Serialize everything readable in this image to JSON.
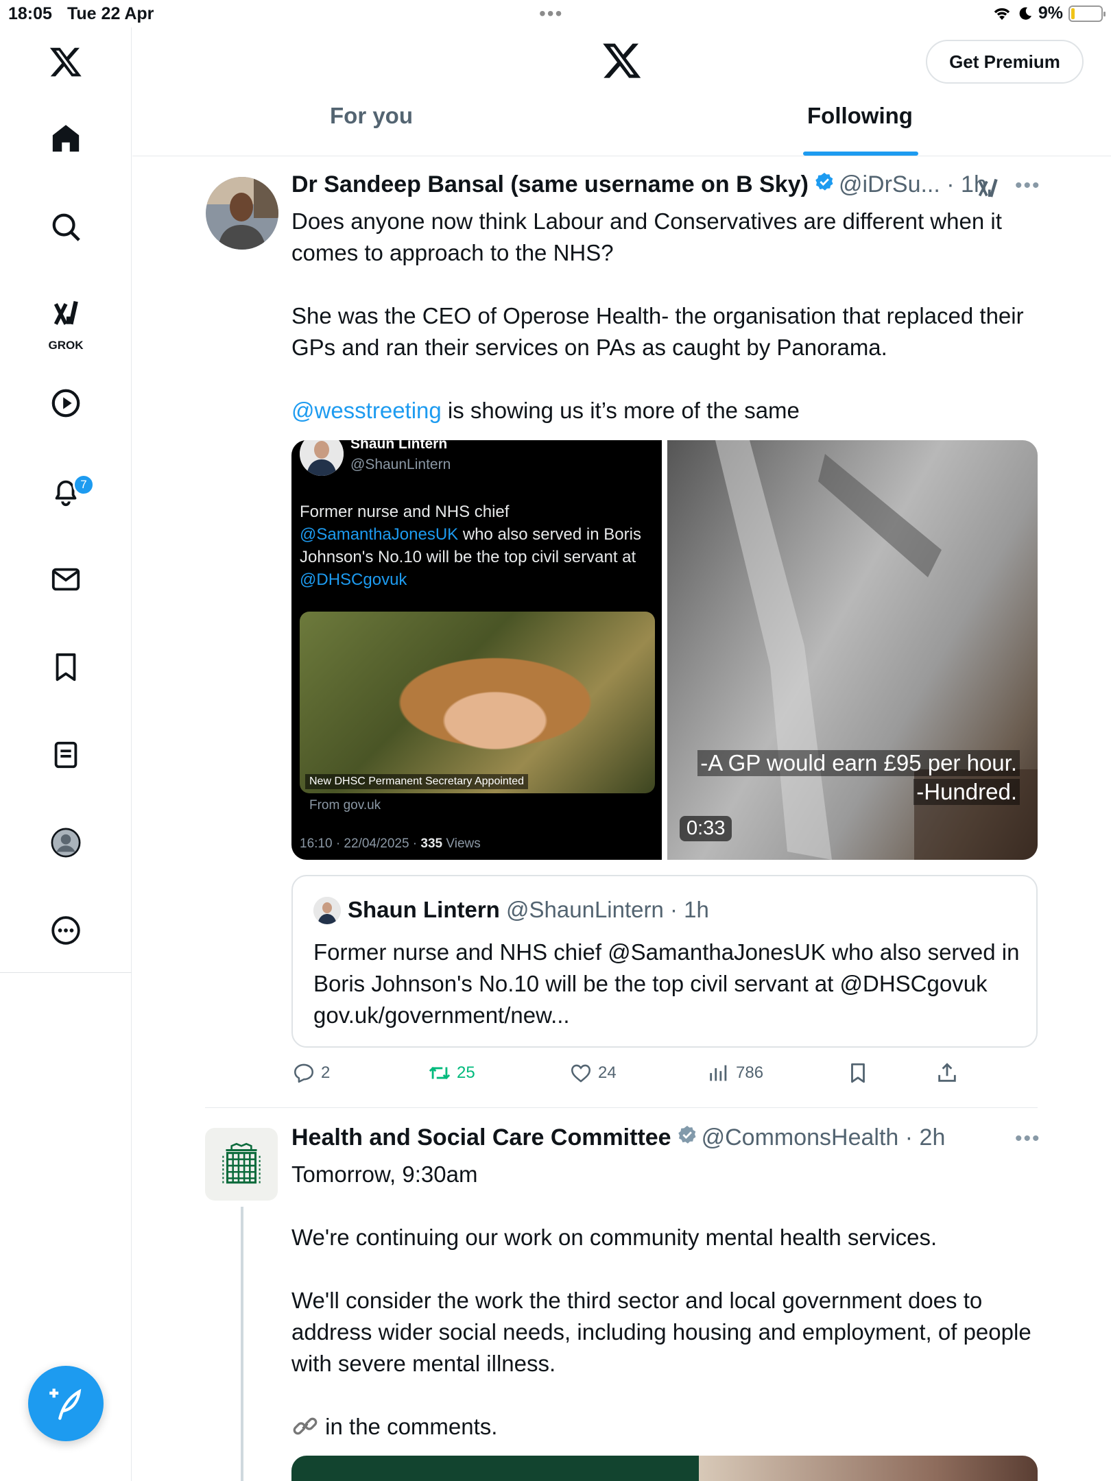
{
  "status": {
    "time": "18:05",
    "date": "Tue 22 Apr",
    "battery": "9%",
    "battery_level": 0.09
  },
  "sidebar": {
    "grok_label": "GROK",
    "notifications_count": "7"
  },
  "header": {
    "premium_label": "Get Premium",
    "tabs": [
      {
        "label": "For you",
        "active": false
      },
      {
        "label": "Following",
        "active": true
      }
    ]
  },
  "tweet1": {
    "name": "Dr Sandeep Bansal (same username on B Sky)",
    "handle_time": "@iDrSu... · 1h",
    "paragraphs": [
      "Does anyone now think Labour and Conservatives are different when it comes to approach to the NHS?",
      "She was the CEO of Operose Health- the organisation that replaced their GPs and ran their services on PAs as caught by Panorama."
    ],
    "mention": "@wesstreeting",
    "mention_rest": " is showing us it’s more of the same",
    "media_left": {
      "name": "Shaun Lintern",
      "handle": "@ShaunLintern",
      "text_a": "Former nurse and NHS chief ",
      "mention_a": "@SamanthaJonesUK",
      "text_b": " who also served in Boris Johnson's No.10 will be the top civil servant at ",
      "mention_b": "@DHSCgovuk",
      "photo_caption": "New DHSC Permanent Secretary Appointed",
      "from": "From gov.uk",
      "stats_prefix": "16:10 · 22/04/2025 · ",
      "views_count": "335",
      "views_label": " Views"
    },
    "media_right": {
      "subtitle_1": "-A GP would earn £95 per hour.",
      "subtitle_2": "-Hundred.",
      "duration": "0:33"
    },
    "quote": {
      "name": "Shaun Lintern",
      "handle_time": "@ShaunLintern · 1h",
      "text": "Former nurse and NHS chief @SamanthaJonesUK who also served in Boris Johnson's No.10 will be the top civil servant at @DHSCgovuk gov.uk/government/new..."
    },
    "actions": {
      "replies": "2",
      "retweets": "25",
      "likes": "24",
      "views": "786"
    }
  },
  "tweet2": {
    "name": "Health and Social Care Committee",
    "handle_time": "@CommonsHealth · 2h",
    "line1": "Tomorrow, 9:30am",
    "paragraphs": [
      "We're continuing our work on community mental health services.",
      "We'll consider the work the third sector and local government does to address wider social needs, including housing and employment, of people with severe mental illness."
    ],
    "link_text": " in the comments."
  },
  "colors": {
    "accent": "#1d9bf0",
    "retweet_green": "#00ba7c",
    "secondary_text": "#536471"
  }
}
